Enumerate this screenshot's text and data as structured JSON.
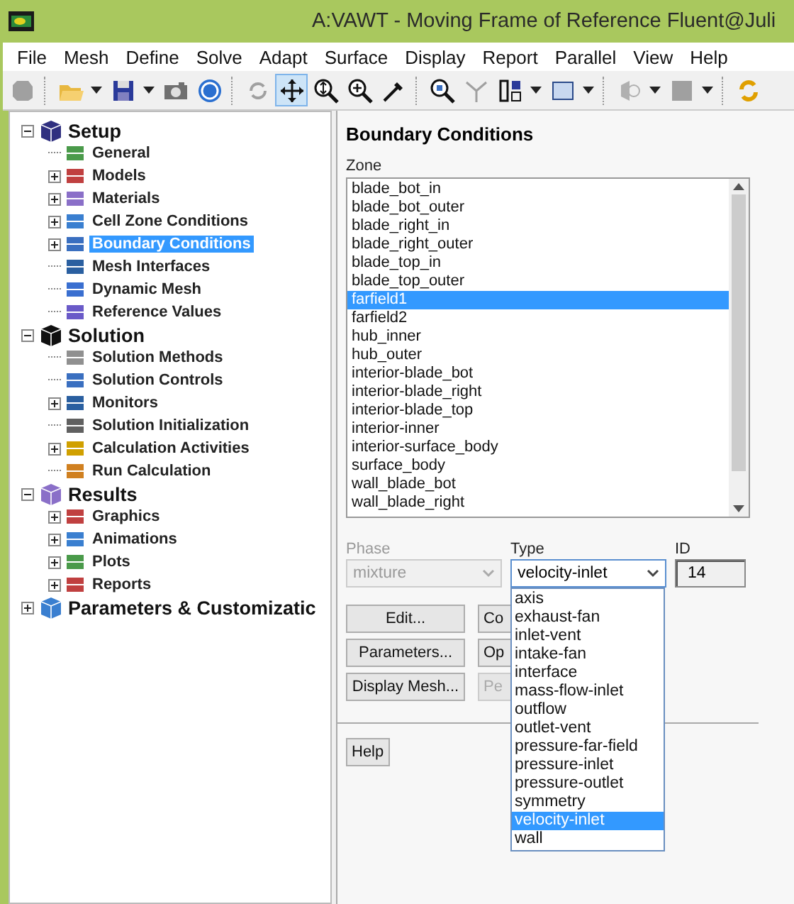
{
  "window": {
    "title": "A:VAWT - Moving Frame of Reference Fluent@Juli"
  },
  "menu": [
    "File",
    "Mesh",
    "Define",
    "Solve",
    "Adapt",
    "Surface",
    "Display",
    "Report",
    "Parallel",
    "View",
    "Help"
  ],
  "toolbar": [
    {
      "selected": false
    },
    {
      "selected": false
    },
    {
      "selected": false
    },
    {
      "selected": false
    },
    {
      "selected": false
    },
    {
      "selected": false
    },
    {
      "selected": true
    },
    {
      "selected": false
    },
    {
      "selected": false
    },
    {
      "selected": false
    },
    {
      "selected": false
    },
    {
      "selected": false
    },
    {
      "selected": false
    },
    {
      "selected": false
    },
    {
      "selected": false
    },
    {
      "selected": false
    },
    {
      "selected": false
    }
  ],
  "tree": [
    {
      "label": "Setup",
      "expanded": true,
      "children": [
        {
          "label": "General",
          "expandable": false,
          "selected": false
        },
        {
          "label": "Models",
          "expandable": true,
          "selected": false
        },
        {
          "label": "Materials",
          "expandable": true,
          "selected": false
        },
        {
          "label": "Cell Zone Conditions",
          "expandable": true,
          "selected": false
        },
        {
          "label": "Boundary Conditions",
          "expandable": true,
          "selected": true
        },
        {
          "label": "Mesh Interfaces",
          "expandable": false,
          "selected": false
        },
        {
          "label": "Dynamic Mesh",
          "expandable": false,
          "selected": false
        },
        {
          "label": "Reference Values",
          "expandable": false,
          "selected": false
        }
      ]
    },
    {
      "label": "Solution",
      "expanded": true,
      "children": [
        {
          "label": "Solution Methods",
          "expandable": false,
          "selected": false
        },
        {
          "label": "Solution Controls",
          "expandable": false,
          "selected": false
        },
        {
          "label": "Monitors",
          "expandable": true,
          "selected": false
        },
        {
          "label": "Solution Initialization",
          "expandable": false,
          "selected": false
        },
        {
          "label": "Calculation Activities",
          "expandable": true,
          "selected": false
        },
        {
          "label": "Run Calculation",
          "expandable": false,
          "selected": false
        }
      ]
    },
    {
      "label": "Results",
      "expanded": true,
      "children": [
        {
          "label": "Graphics",
          "expandable": true,
          "selected": false
        },
        {
          "label": "Animations",
          "expandable": true,
          "selected": false
        },
        {
          "label": "Plots",
          "expandable": true,
          "selected": false
        },
        {
          "label": "Reports",
          "expandable": true,
          "selected": false
        }
      ]
    },
    {
      "label": "Parameters & Customizatic",
      "expanded": false
    }
  ],
  "panel": {
    "title": "Boundary Conditions",
    "zone_label": "Zone",
    "zones": [
      {
        "label": "blade_bot_in",
        "selected": false
      },
      {
        "label": "blade_bot_outer",
        "selected": false
      },
      {
        "label": "blade_right_in",
        "selected": false
      },
      {
        "label": "blade_right_outer",
        "selected": false
      },
      {
        "label": "blade_top_in",
        "selected": false
      },
      {
        "label": "blade_top_outer",
        "selected": false
      },
      {
        "label": "farfield1",
        "selected": true
      },
      {
        "label": "farfield2",
        "selected": false
      },
      {
        "label": "hub_inner",
        "selected": false
      },
      {
        "label": "hub_outer",
        "selected": false
      },
      {
        "label": "interior-blade_bot",
        "selected": false
      },
      {
        "label": "interior-blade_right",
        "selected": false
      },
      {
        "label": "interior-blade_top",
        "selected": false
      },
      {
        "label": "interior-inner",
        "selected": false
      },
      {
        "label": "interior-surface_body",
        "selected": false
      },
      {
        "label": "surface_body",
        "selected": false
      },
      {
        "label": "wall_blade_bot",
        "selected": false
      },
      {
        "label": "wall_blade_right",
        "selected": false
      }
    ],
    "phase": {
      "label": "Phase",
      "value": "mixture",
      "disabled": true
    },
    "type": {
      "label": "Type",
      "value": "velocity-inlet",
      "expanded": true
    },
    "id": {
      "label": "ID",
      "value": "14"
    },
    "buttons": [
      {
        "label": "Edit...",
        "disabled": false
      },
      {
        "label": "Co",
        "disabled": false
      },
      {
        "label": "Parameters...",
        "disabled": false
      },
      {
        "label": "Op",
        "disabled": false
      },
      {
        "label": "Display Mesh...",
        "disabled": false
      },
      {
        "label": "Pe",
        "disabled": true
      }
    ],
    "type_options": [
      {
        "label": "axis",
        "selected": false
      },
      {
        "label": "exhaust-fan",
        "selected": false
      },
      {
        "label": "inlet-vent",
        "selected": false
      },
      {
        "label": "intake-fan",
        "selected": false
      },
      {
        "label": "interface",
        "selected": false
      },
      {
        "label": "mass-flow-inlet",
        "selected": false
      },
      {
        "label": "outflow",
        "selected": false
      },
      {
        "label": "outlet-vent",
        "selected": false
      },
      {
        "label": "pressure-far-field",
        "selected": false
      },
      {
        "label": "pressure-inlet",
        "selected": false
      },
      {
        "label": "pressure-outlet",
        "selected": false
      },
      {
        "label": "symmetry",
        "selected": false
      },
      {
        "label": "velocity-inlet",
        "selected": true
      },
      {
        "label": "wall",
        "selected": false
      }
    ],
    "help": "Help"
  }
}
